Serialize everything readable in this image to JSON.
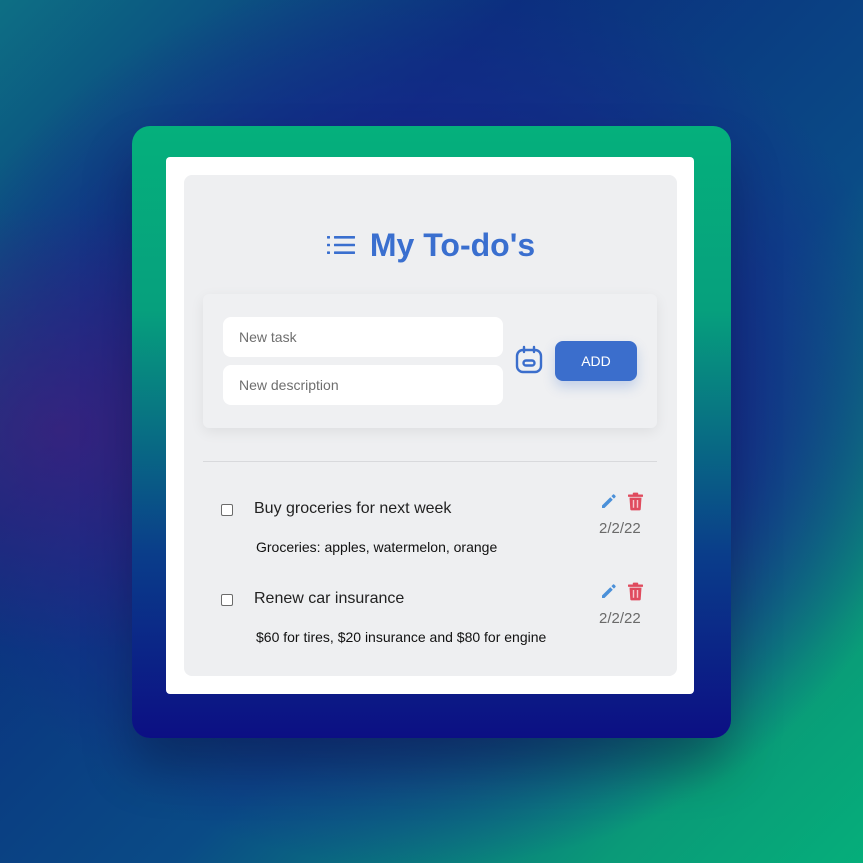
{
  "header": {
    "title": "My To-do's",
    "icon": "list-icon"
  },
  "form": {
    "task_placeholder": "New task",
    "description_placeholder": "New description",
    "calendar_icon": "calendar-icon",
    "add_label": "ADD"
  },
  "todos": [
    {
      "title": "Buy groceries for next week",
      "description": "Groceries: apples, watermelon, orange",
      "date": "2/2/22",
      "checked": false
    },
    {
      "title": "Renew car insurance",
      "description": "$60 for tires, $20 insurance and $80 for engine",
      "date": "2/2/22",
      "checked": false
    }
  ],
  "colors": {
    "accent": "#3b6ecc",
    "edit": "#4a90d9",
    "delete": "#e04b5e",
    "frame_top": "#05b07c",
    "frame_bottom": "#0c0f84"
  }
}
